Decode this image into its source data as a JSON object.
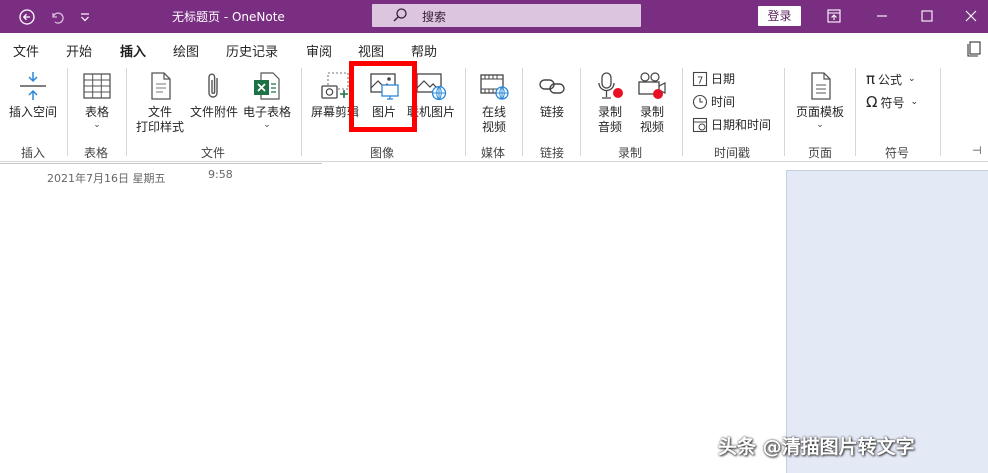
{
  "titlebar": {
    "doc_title": "无标题页  -  OneNote",
    "search_placeholder": "搜索",
    "login_label": "登录",
    "icons": [
      "back-icon",
      "undo-icon",
      "customize-icon",
      "ribbon-display-icon",
      "minimize-icon",
      "maximize-icon",
      "close-icon"
    ]
  },
  "tabs": [
    "文件",
    "开始",
    "插入",
    "绘图",
    "历史记录",
    "审阅",
    "视图",
    "帮助"
  ],
  "active_tab": "插入",
  "ribbon": {
    "insert_space": "插入空间",
    "table": "表格",
    "file_printout_1": "文件",
    "file_printout_2": "打印样式",
    "file_attachment": "文件附件",
    "spreadsheet": "电子表格",
    "screen_clip": "屏幕剪辑",
    "pictures": "图片",
    "online_pictures": "联机图片",
    "online_video_1": "在线",
    "online_video_2": "视频",
    "link": "链接",
    "record_audio_1": "录制",
    "record_audio_2": "音频",
    "record_video_1": "录制",
    "record_video_2": "视频",
    "date": "日期",
    "time": "时间",
    "date_time": "日期和时间",
    "page_templates": "页面模板",
    "equation": "公式",
    "symbol": "符号",
    "groups": {
      "insert": "插入",
      "tables": "表格",
      "files": "文件",
      "images": "图像",
      "media": "媒体",
      "links": "链接",
      "recording": "录制",
      "timestamp": "时间戳",
      "pages": "页面",
      "symbols": "符号"
    }
  },
  "page": {
    "date": "2021年7月16日 星期五",
    "time": "9:58"
  },
  "watermark": "头条 @清描图片转文字",
  "colors": {
    "titlebar": "#7a2e82",
    "highlight": "#ff0000",
    "side_panel": "#e4e9f6"
  }
}
